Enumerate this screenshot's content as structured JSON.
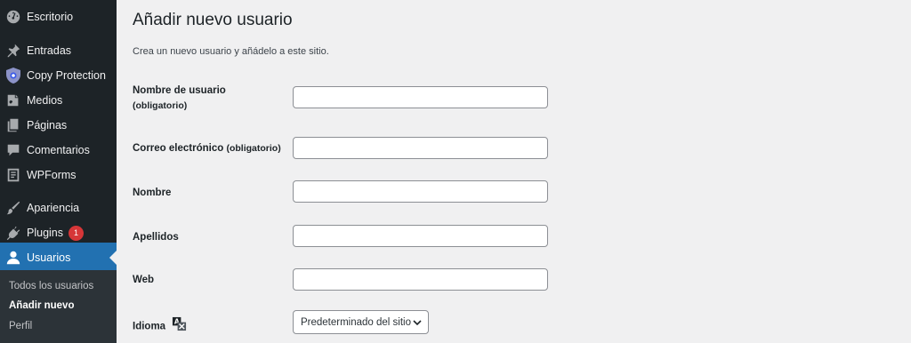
{
  "sidebar": {
    "items": [
      {
        "label": "Escritorio",
        "icon": "dashboard-icon"
      },
      {
        "label": "Entradas",
        "icon": "pin-icon"
      },
      {
        "label": "Copy Protection",
        "icon": "shield-icon"
      },
      {
        "label": "Medios",
        "icon": "media-icon"
      },
      {
        "label": "Páginas",
        "icon": "pages-icon"
      },
      {
        "label": "Comentarios",
        "icon": "comment-icon"
      },
      {
        "label": "WPForms",
        "icon": "forms-icon"
      },
      {
        "label": "Apariencia",
        "icon": "brush-icon"
      },
      {
        "label": "Plugins",
        "icon": "plugin-icon",
        "badge": "1"
      },
      {
        "label": "Usuarios",
        "icon": "user-icon"
      }
    ],
    "submenu": [
      {
        "label": "Todos los usuarios"
      },
      {
        "label": "Añadir nuevo"
      },
      {
        "label": "Perfil"
      }
    ]
  },
  "main": {
    "title": "Añadir nuevo usuario",
    "description": "Crea un nuevo usuario y añádelo a este sitio.",
    "fields": [
      {
        "label": "Nombre de usuario",
        "required": "(obligatorio)",
        "value": ""
      },
      {
        "label": "Correo electrónico",
        "required": "(obligatorio)",
        "value": ""
      },
      {
        "label": "Nombre",
        "value": ""
      },
      {
        "label": "Apellidos",
        "value": ""
      },
      {
        "label": "Web",
        "value": ""
      }
    ],
    "language": {
      "label": "Idioma",
      "selected": "Predeterminado del sitio"
    }
  },
  "colors": {
    "sidebar": "#1d2327",
    "accent": "#2271b1",
    "badge": "#d63638"
  }
}
